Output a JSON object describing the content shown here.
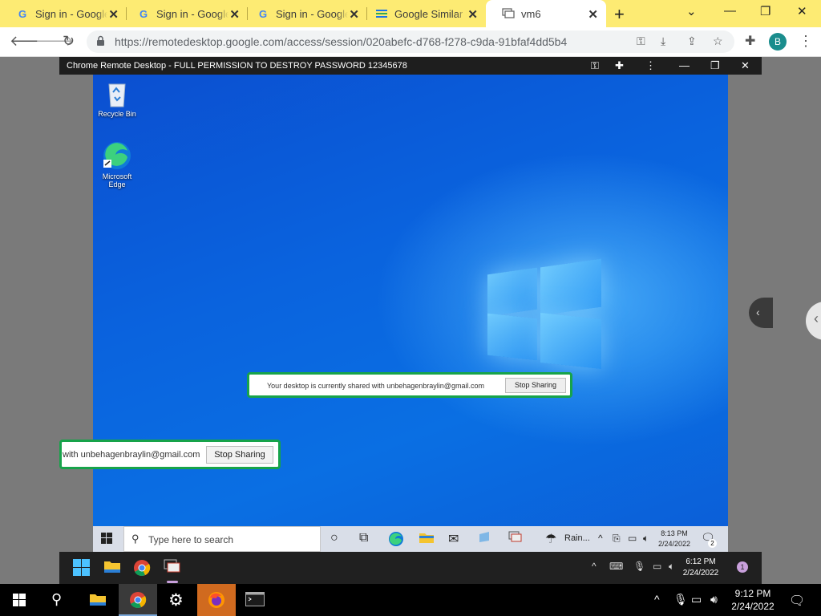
{
  "browser": {
    "tabs": [
      {
        "title": "Sign in - Google Accounts",
        "icon": "google-icon",
        "active": false
      },
      {
        "title": "Sign in - Google Accounts",
        "icon": "google-icon",
        "active": false
      },
      {
        "title": "Sign in - Google Accounts",
        "icon": "google-icon",
        "active": false
      },
      {
        "title": "Google Similar Pages",
        "icon": "stack-icon",
        "active": false
      },
      {
        "title": "vm6",
        "icon": "remote-desktop-icon",
        "active": true
      }
    ],
    "url": "https://remotedesktop.google.com/access/session/020abefc-d768-f278-c9da-91bfaf4dd5b4",
    "profile_initial": "B"
  },
  "remote_window": {
    "title": "Chrome Remote Desktop - FULL PERMISSION TO DESTROY PASSWORD 12345678"
  },
  "desktop": {
    "icons": [
      {
        "label": "Recycle Bin",
        "icon": "recycle-bin-icon"
      },
      {
        "label": "Microsoft Edge",
        "icon": "edge-icon"
      }
    ],
    "share_banner": {
      "message": "Your desktop is currently shared with unbehagenbraylin@gmail.com",
      "button": "Stop Sharing"
    },
    "share_banner_partial": {
      "message": "with unbehagenbraylin@gmail.com",
      "button": "Stop Sharing"
    }
  },
  "remote_taskbar": {
    "search_placeholder": "Type here to search",
    "weather": "Rain...",
    "time": "8:13 PM",
    "date": "2/24/2022",
    "notification_count": "2"
  },
  "vm_taskbar": {
    "time": "6:12 PM",
    "date": "2/24/2022",
    "notification_count": "1"
  },
  "host_taskbar": {
    "time": "9:12 PM",
    "date": "2/24/2022"
  },
  "colors": {
    "tabstrip": "#fdeb73",
    "share_border": "#17a34a",
    "desktop_blue": "#0a63de"
  }
}
